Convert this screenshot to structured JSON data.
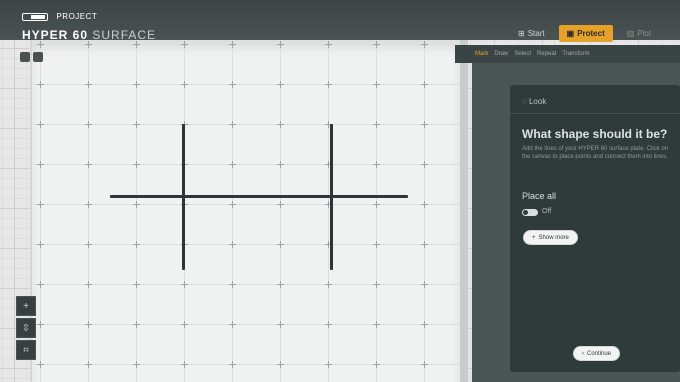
{
  "app": {
    "brand_kicker": "PROJECT",
    "brand_title": "HYPER 60",
    "brand_subtitle": "SURFACE"
  },
  "toolbar": {
    "items": [
      {
        "label": "Start",
        "icon": "grid-icon",
        "state": "normal"
      },
      {
        "label": "Protect",
        "icon": "shield-icon",
        "state": "active"
      },
      {
        "label": "Plot",
        "icon": "chart-icon",
        "state": "disabled"
      }
    ],
    "accent": "#e4a22a"
  },
  "subtabs": [
    "Mark",
    "Draw",
    "Select",
    "Repeat",
    "Transform"
  ],
  "panel": {
    "step_label": "Look",
    "question": "What shape should it be?",
    "description": "Add the lines of your HYPER 60 surface plate. Click on the canvas to place points and connect them into lines.",
    "mode_label": "Place all",
    "toggle_label": "Off",
    "show_button": "Show more",
    "continue_button": "Continue"
  },
  "left_tools": [
    "add-icon",
    "expand-icon",
    "crop-icon"
  ],
  "canvas": {
    "description_visible": false
  }
}
